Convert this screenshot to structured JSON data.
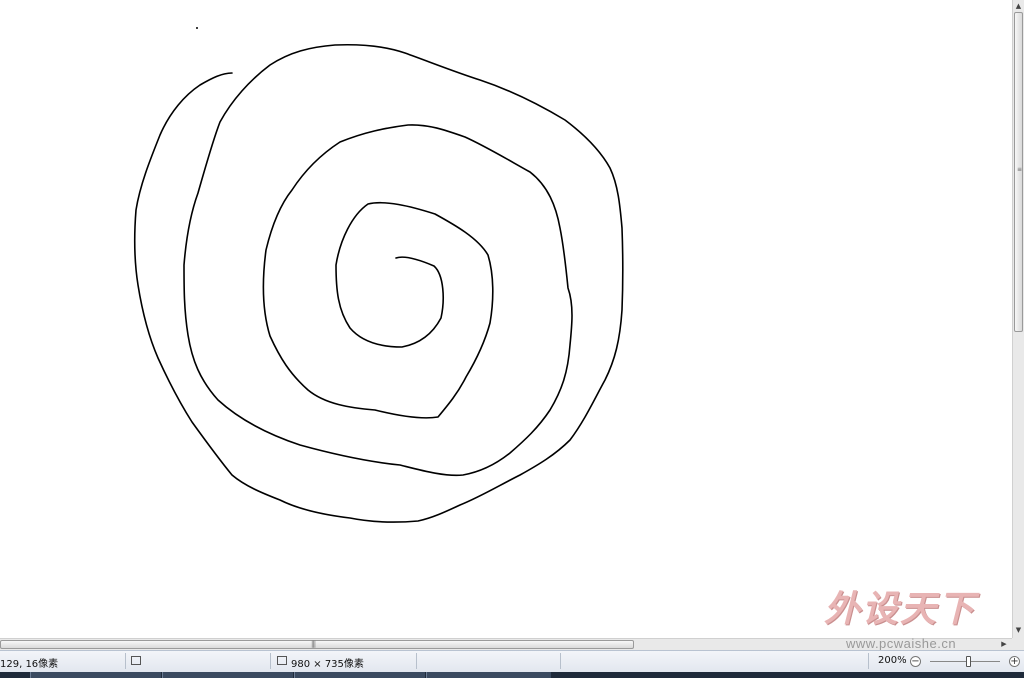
{
  "statusbar": {
    "cursor_position": "129, 16像素",
    "image_size": "980 × 735像素",
    "zoom_level": "200%",
    "zoom_out_symbol": "−",
    "zoom_in_symbol": "+"
  },
  "watermark": {
    "logo_text": "外设天下",
    "url_text": "www.pcwaishe.cn"
  },
  "icons": {
    "selection": "selection-size-icon",
    "image_size": "image-size-icon",
    "zoom_out": "zoom-out-icon",
    "zoom_in": "zoom-in-icon"
  },
  "colors": {
    "stroke": "#000000",
    "canvas": "#ffffff",
    "watermark": "#e8b4b4"
  }
}
